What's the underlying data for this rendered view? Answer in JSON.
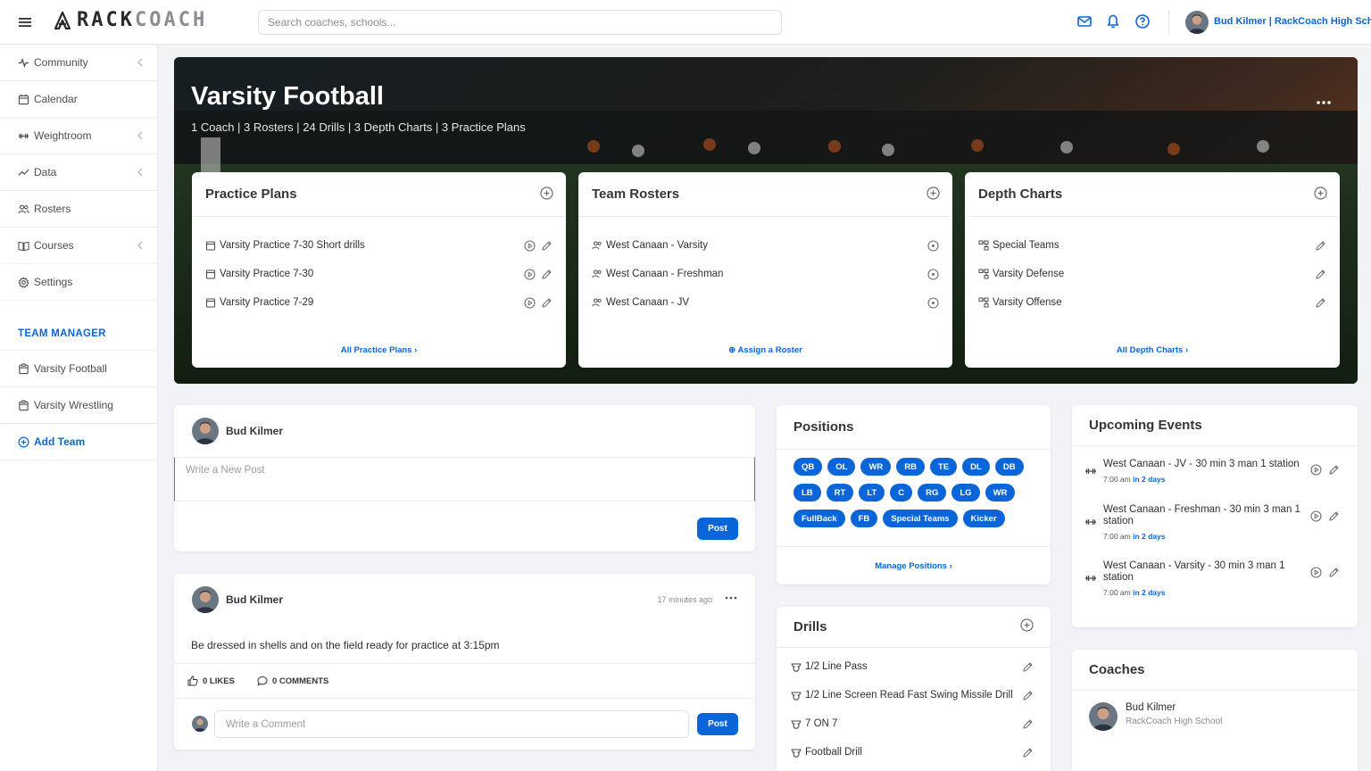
{
  "app": {
    "logo_bold": "RACK",
    "logo_light": "COACH",
    "search_placeholder": "Search coaches, schools...",
    "user_label": "Bud Kilmer | RackCoach High School"
  },
  "sidebar": {
    "items": [
      {
        "label": "Community",
        "icon": "pulse-icon",
        "chevron": true
      },
      {
        "label": "Calendar",
        "icon": "calendar-icon",
        "chevron": false
      },
      {
        "label": "Weightroom",
        "icon": "dumbbell-icon",
        "chevron": true
      },
      {
        "label": "Data",
        "icon": "chart-line-icon",
        "chevron": true
      },
      {
        "label": "Rosters",
        "icon": "users-icon",
        "chevron": false
      },
      {
        "label": "Courses",
        "icon": "book-icon",
        "chevron": true
      },
      {
        "label": "Settings",
        "icon": "gear-icon",
        "chevron": false
      }
    ],
    "section_heading": "TEAM MANAGER",
    "teams": [
      "Varsity Football",
      "Varsity Wrestling"
    ],
    "add_team": "Add Team"
  },
  "hero": {
    "title": "Varsity Football",
    "subtitle": "1 Coach | 3 Rosters | 24 Drills | 3 Depth Charts | 3 Practice Plans"
  },
  "practice_plans": {
    "title": "Practice Plans",
    "items": [
      "Varsity Practice 7-30 Short drills",
      "Varsity Practice 7-30",
      "Varsity Practice 7-29"
    ],
    "footer": "All Practice Plans"
  },
  "team_rosters": {
    "title": "Team Rosters",
    "items": [
      "West Canaan - Varsity",
      "West Canaan - Freshman",
      "West Canaan - JV"
    ],
    "footer": "Assign a Roster"
  },
  "depth_charts": {
    "title": "Depth Charts",
    "items": [
      "Special Teams",
      "Varsity Defense",
      "Varsity Offense"
    ],
    "footer": "All Depth Charts"
  },
  "new_post": {
    "author": "Bud Kilmer",
    "placeholder": "Write a New Post",
    "button": "Post"
  },
  "feed_post": {
    "author": "Bud Kilmer",
    "time": "17 minutes ago",
    "text": "Be dressed in shells and on the field ready for practice at 3:15pm",
    "likes": "0 LIKES",
    "comments": "0 COMMENTS",
    "comment_placeholder": "Write a Comment",
    "button": "Post"
  },
  "positions": {
    "title": "Positions",
    "chips": [
      "QB",
      "OL",
      "WR",
      "RB",
      "TE",
      "DL",
      "DB",
      "LB",
      "RT",
      "LT",
      "C",
      "RG",
      "LG",
      "WR",
      "FullBack",
      "FB",
      "Special Teams",
      "Kicker"
    ],
    "footer": "Manage Positions"
  },
  "drills": {
    "title": "Drills",
    "items": [
      "1/2 Line Pass",
      "1/2 Line Screen Read Fast Swing Missile Drill",
      "7 ON 7",
      "Football Drill"
    ]
  },
  "events": {
    "title": "Upcoming Events",
    "items": [
      {
        "title": "West Canaan - JV - 30 min 3 man 1 station",
        "time": "7:00 am",
        "relative": "in 2 days"
      },
      {
        "title": "West Canaan - Freshman - 30 min 3 man 1 station",
        "time": "7:00 am",
        "relative": "in 2 days"
      },
      {
        "title": "West Canaan - Varsity - 30 min 3 man 1 station",
        "time": "7:00 am",
        "relative": "in 2 days"
      }
    ]
  },
  "coaches": {
    "title": "Coaches",
    "items": [
      {
        "name": "Bud Kilmer",
        "school": "RackCoach High School"
      }
    ]
  },
  "colors": {
    "accent": "#0a66d8",
    "background": "#f1f3f6"
  }
}
